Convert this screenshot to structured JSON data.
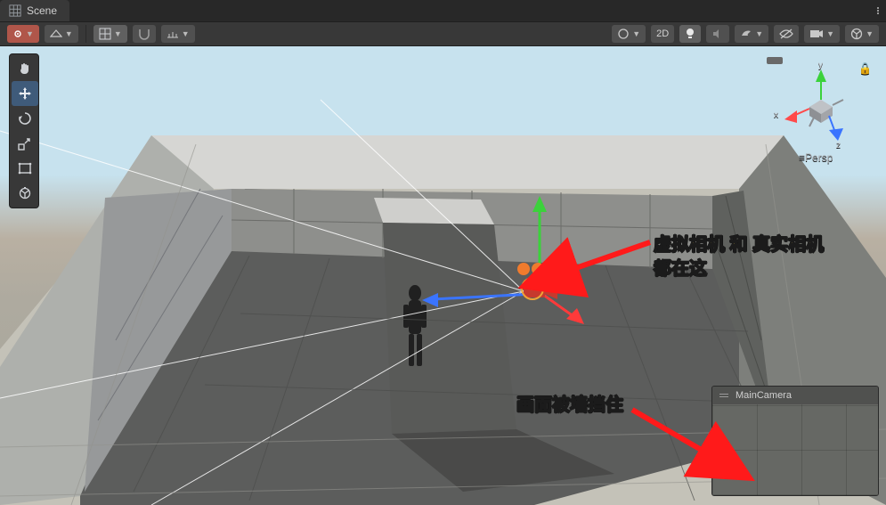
{
  "tab": {
    "label": "Scene"
  },
  "toolbar": {
    "label_2d": "2D"
  },
  "gizmo": {
    "axis_x": "x",
    "axis_y": "y",
    "axis_z": "z",
    "projection": "Persp",
    "projection_prefix": "≡"
  },
  "camera_preview": {
    "title": "MainCamera"
  },
  "annotations": {
    "camera_note_line1": "虚拟相机 和 真实相机",
    "camera_note_line2": "都在这",
    "wall_note": "画面被墙挡住"
  }
}
